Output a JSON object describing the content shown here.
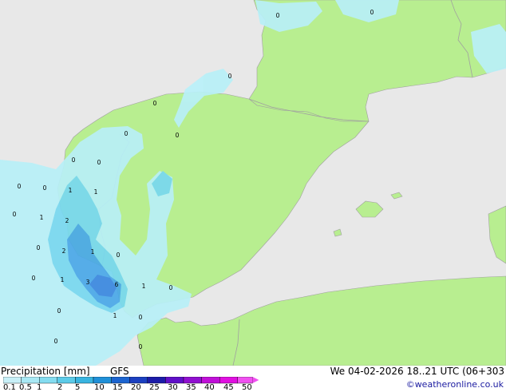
{
  "title": "Precipitation [mm]",
  "model": "GFS",
  "valid_time": "We 04-02-2026 18..21 UTC (06+303",
  "credit": "©weatheronline.co.uk",
  "legend": {
    "ticks": [
      "0.1",
      "0.5",
      "1",
      "2",
      "5",
      "10",
      "15",
      "20",
      "25",
      "30",
      "35",
      "40",
      "45",
      "50"
    ],
    "colors": [
      "#c8f0f8",
      "#a8e8f4",
      "#84dcf0",
      "#5ccbe8",
      "#38b4e0",
      "#2090d8",
      "#1c64d0",
      "#1c40c0",
      "#1c1ca8",
      "#6010c8",
      "#9010d0",
      "#c010d8",
      "#e010e0",
      "#f050f0"
    ]
  },
  "colors": {
    "land": "#b8ee90",
    "sea": "#e8e8e8",
    "border": "#a0a0a0",
    "light_precip": "#b8f0f8",
    "medium_precip": "#78d8f0",
    "heavy_precip": "#4aa8e8"
  },
  "map_labels": [
    {
      "text": "0"
    },
    {
      "text": "0"
    },
    {
      "text": "0"
    },
    {
      "text": "0"
    },
    {
      "text": "0"
    },
    {
      "text": "0"
    },
    {
      "text": "0"
    },
    {
      "text": "0"
    },
    {
      "text": "1"
    },
    {
      "text": "1"
    },
    {
      "text": "0"
    },
    {
      "text": "0"
    },
    {
      "text": "0"
    },
    {
      "text": "1"
    },
    {
      "text": "2"
    },
    {
      "text": "0"
    },
    {
      "text": "2"
    },
    {
      "text": "1"
    },
    {
      "text": "0"
    },
    {
      "text": "0"
    },
    {
      "text": "1"
    },
    {
      "text": "3"
    },
    {
      "text": "6"
    },
    {
      "text": "1"
    },
    {
      "text": "0"
    },
    {
      "text": "0"
    },
    {
      "text": "1"
    },
    {
      "text": "0"
    },
    {
      "text": "0"
    },
    {
      "text": "0"
    }
  ]
}
